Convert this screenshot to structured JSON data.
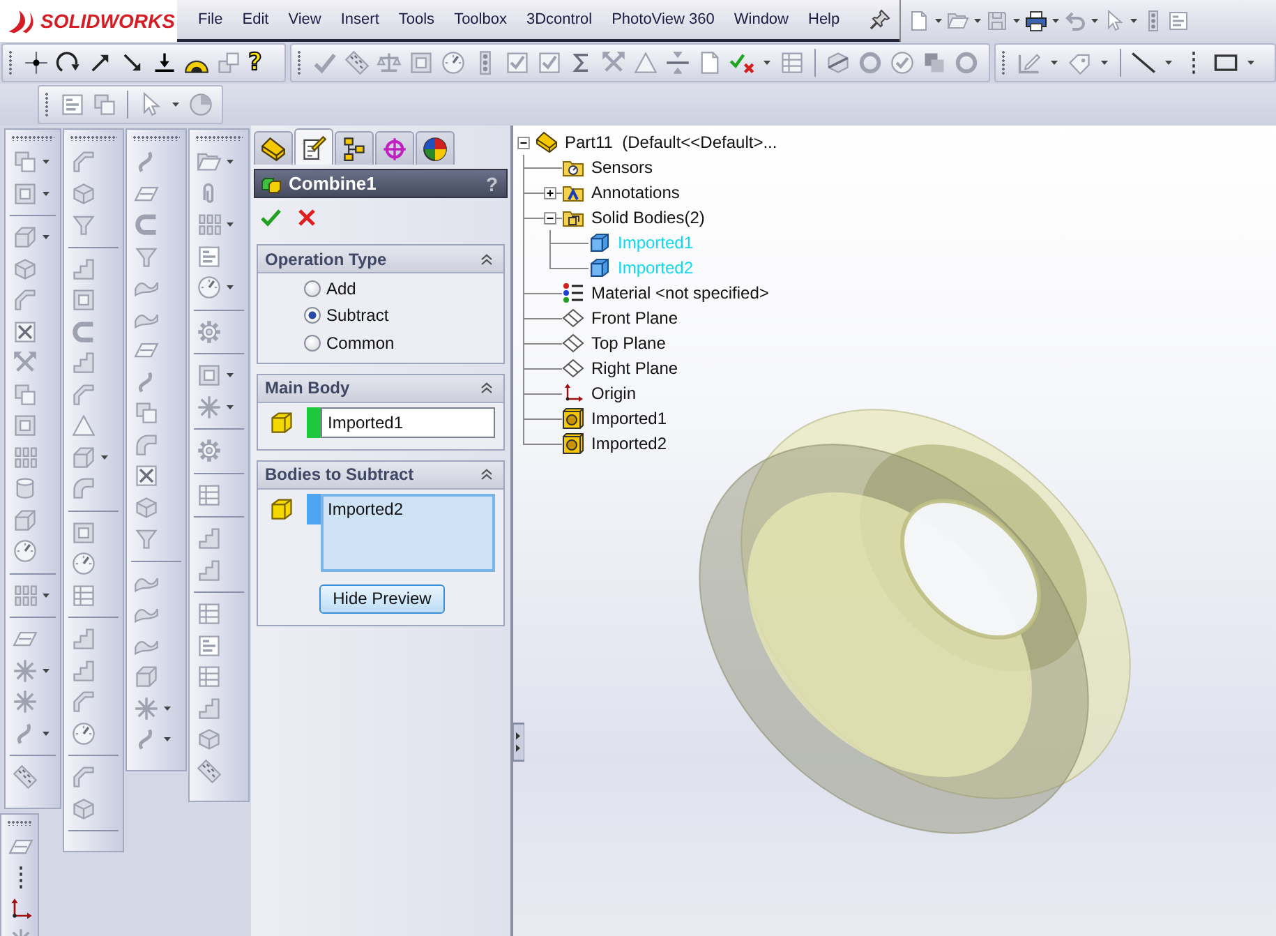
{
  "logo": {
    "text": "SOLIDWORKS"
  },
  "menu": [
    {
      "label": "File"
    },
    {
      "label": "Edit"
    },
    {
      "label": "View"
    },
    {
      "label": "Insert"
    },
    {
      "label": "Tools"
    },
    {
      "label": "Toolbox"
    },
    {
      "label": "3Dcontrol"
    },
    {
      "label": "PhotoView 360"
    },
    {
      "label": "Window"
    },
    {
      "label": "Help"
    }
  ],
  "toolbar": {
    "help": "?"
  },
  "property_manager": {
    "tabs": [
      {
        "selected": false
      },
      {
        "selected": true
      },
      {
        "selected": false
      },
      {
        "selected": false
      },
      {
        "selected": false
      }
    ],
    "title": "Combine1",
    "help": "?",
    "sections": [
      {
        "kind": "options",
        "title": "Operation Type",
        "options": [
          {
            "label": "Add",
            "selected": false
          },
          {
            "label": "Subtract",
            "selected": true
          },
          {
            "label": "Common",
            "selected": false
          }
        ]
      },
      {
        "kind": "single_list",
        "title": "Main Body",
        "value": "Imported1",
        "color": "#1ec83c",
        "focused": false
      },
      {
        "kind": "multi_list",
        "title": "Bodies to Subtract",
        "value": "Imported2",
        "color": "#4ea6f2",
        "focused": true,
        "button": "Hide Preview"
      }
    ]
  },
  "feature_tree": {
    "root": {
      "label": "Part11  (Default<<Default>...",
      "kind": "part",
      "highlighted": false,
      "expanded": true,
      "children": [
        {
          "label": "Sensors",
          "kind": "sensors",
          "highlighted": false
        },
        {
          "label": "Annotations",
          "kind": "annotations",
          "highlighted": false,
          "expanded": false
        },
        {
          "label": "Solid Bodies(2)",
          "kind": "bodies",
          "highlighted": false,
          "expanded": true,
          "children": [
            {
              "label": "Imported1",
              "kind": "body",
              "highlighted": true
            },
            {
              "label": "Imported2",
              "kind": "body",
              "highlighted": true
            }
          ]
        },
        {
          "label": "Material <not specified>",
          "kind": "material",
          "highlighted": false
        },
        {
          "label": "Front Plane",
          "kind": "plane",
          "highlighted": false
        },
        {
          "label": "Top Plane",
          "kind": "plane",
          "highlighted": false
        },
        {
          "label": "Right Plane",
          "kind": "plane",
          "highlighted": false
        },
        {
          "label": "Origin",
          "kind": "origin",
          "highlighted": false
        },
        {
          "label": "Imported1",
          "kind": "feature",
          "highlighted": false
        },
        {
          "label": "Imported2",
          "kind": "feature",
          "highlighted": false
        }
      ]
    }
  }
}
